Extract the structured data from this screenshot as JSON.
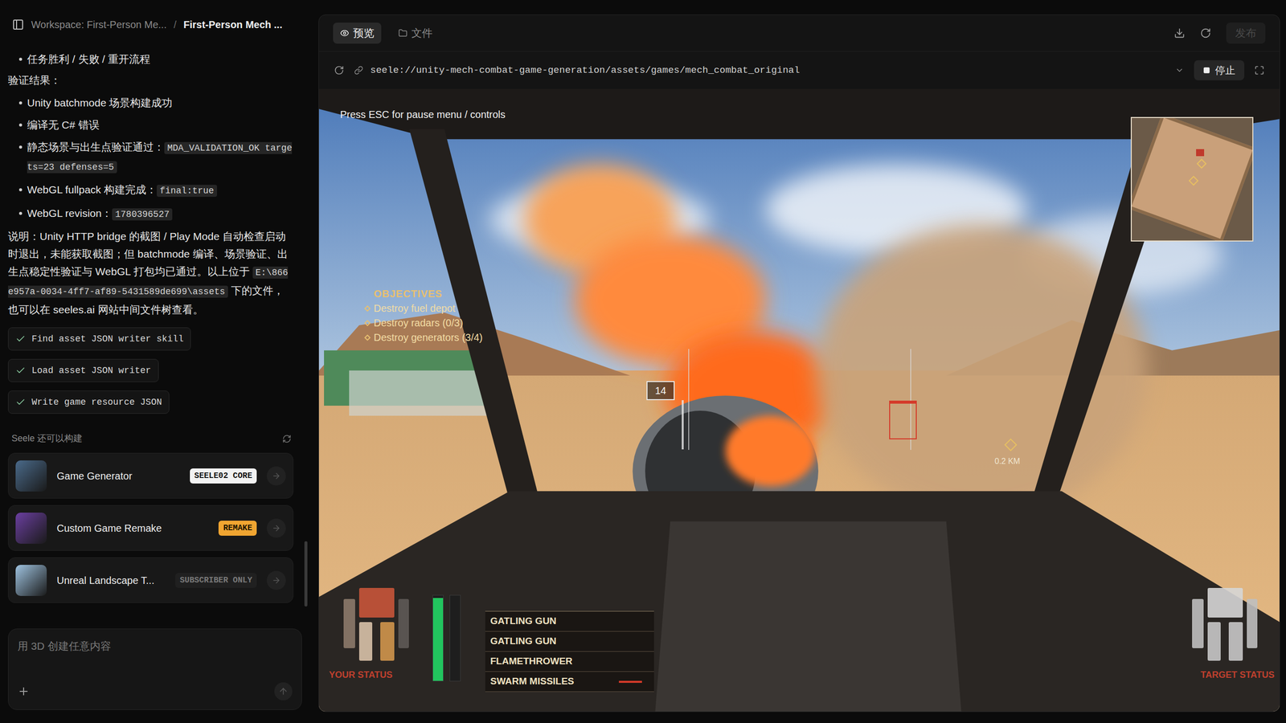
{
  "breadcrumb": {
    "workspace": "Workspace: First-Person Me...",
    "separator": "/",
    "current": "First-Person Mech ..."
  },
  "chat": {
    "top_bullets": [
      "任务胜利 / 失败 / 重开流程"
    ],
    "heading": "验证结果：",
    "results": [
      {
        "text": "Unity batchmode 场景构建成功"
      },
      {
        "text": "编译无 C# 错误"
      },
      {
        "text": "静态场景与出生点验证通过：",
        "code": "MDA_VALIDATION_OK targets=23 defenses=5"
      },
      {
        "text": "WebGL fullpack 构建完成：",
        "code": "final:true"
      },
      {
        "text": "WebGL revision：",
        "code": "1780396527"
      }
    ],
    "note": [
      {
        "text": "说明：Unity HTTP bridge 的截图 / Play Mode 自动检查启动时退出，未能获取截图；但 batchmode 编译、场景验证、出生点稳定性验证与 WebGL 打包均已通过。以上位于 "
      },
      {
        "code": "E:\\866e957a-0034-4ff7-af89-5431589de699\\assets"
      },
      {
        "text": " 下的文件，也可以在 seeles.ai 网站中间文件树查看。"
      }
    ],
    "steps": [
      {
        "label": "Find asset JSON writer skill",
        "done": true
      },
      {
        "label": "Load asset JSON writer",
        "done": true
      },
      {
        "label": "Write game resource JSON",
        "done": true
      }
    ]
  },
  "suggestions": {
    "title": "Seele 还可以构建",
    "items": [
      {
        "name": "Game Generator",
        "badge": "SEELE02 CORE",
        "kind": "core",
        "color": "#4a6a8a"
      },
      {
        "name": "Custom Game Remake",
        "badge": "REMAKE",
        "kind": "remake",
        "color": "#6b3fa0"
      },
      {
        "name": "Unreal Landscape T...",
        "badge": "SUBSCRIBER ONLY",
        "kind": "subscriber",
        "color": "#9fc3e0"
      }
    ]
  },
  "composer": {
    "placeholder": "用 3D 创建任意内容"
  },
  "preview": {
    "tabs": [
      {
        "label": "预览",
        "selected": true
      },
      {
        "label": "文件",
        "selected": false
      }
    ],
    "publish": {
      "label": "发布",
      "disabled": true
    },
    "url": "seele://unity-mech-combat-game-generation/assets/games/mech_combat_original",
    "stop": "停止"
  },
  "game": {
    "hint": "Press ESC for pause menu / controls",
    "objectives": {
      "title": "OBJECTIVES",
      "items": [
        "Destroy fuel depot",
        "Destroy radars (0/3)",
        "Destroy generators (3/4)"
      ]
    },
    "target_label": "14",
    "waypoint": "0.2 KM",
    "weapons": [
      {
        "name": "GATLING GUN",
        "reloading": false
      },
      {
        "name": "GATLING GUN",
        "reloading": false
      },
      {
        "name": "FLAMETHROWER",
        "reloading": false
      },
      {
        "name": "SWARM MISSILES",
        "reloading": true
      }
    ],
    "your_status": {
      "label": "YOUR STATUS",
      "parts": [
        {
          "color": "#c8553a"
        },
        {
          "color": "#8c7a6a"
        },
        {
          "color": "#5e5a56"
        },
        {
          "color": "#d8c2a8"
        },
        {
          "color": "#d0964c"
        }
      ],
      "meters": [
        {
          "level": 0.97,
          "color": "#22c55e"
        },
        {
          "level": 0,
          "color": "#3a3a3a"
        }
      ]
    },
    "target_status": {
      "label": "TARGET STATUS",
      "parts": [
        {
          "color": "#d6d6d6"
        },
        {
          "color": "#bfbfbf"
        },
        {
          "color": "#bfbfbf"
        },
        {
          "color": "#c8c8c8"
        },
        {
          "color": "#c8c8c8"
        }
      ]
    }
  }
}
